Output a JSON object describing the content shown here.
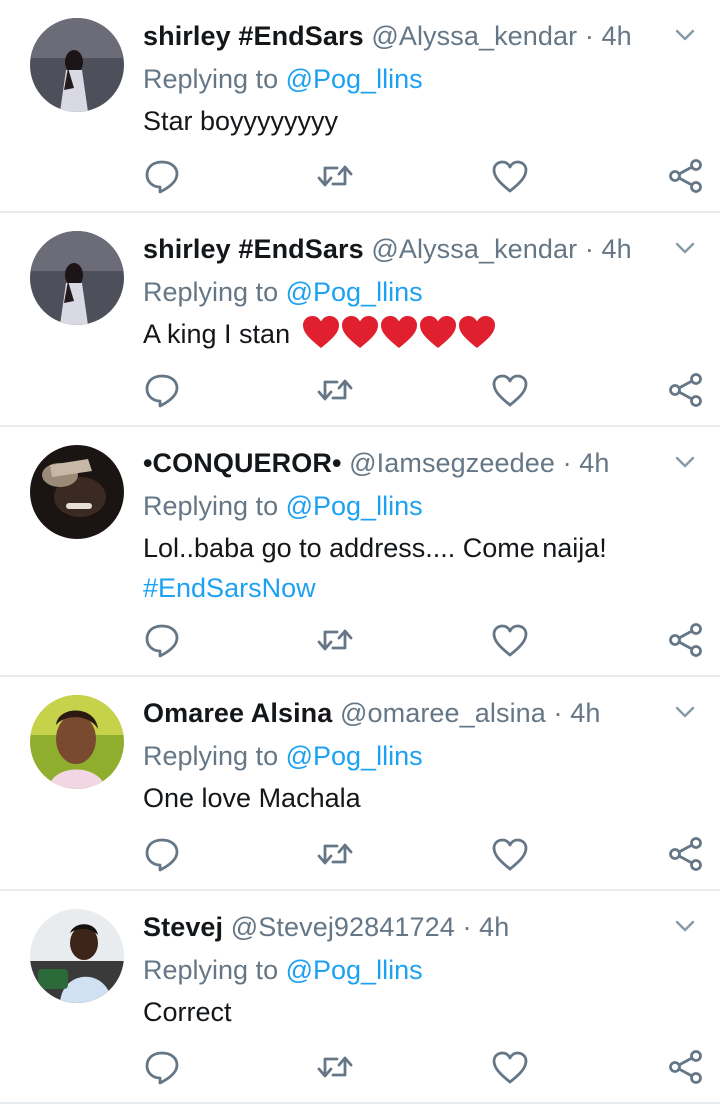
{
  "replying_prefix": "Replying to",
  "tweets": [
    {
      "name": "shirley #EndSars",
      "handle": "@Alyssa_kendar",
      "separator": "·",
      "time": "4h",
      "mention": "@Pog_llins",
      "text": "Star boyyyyyyyy"
    },
    {
      "name": "shirley #EndSars",
      "handle": "@Alyssa_kendar",
      "separator": "·",
      "time": "4h",
      "mention": "@Pog_llins",
      "text": "A king I stan",
      "emoji": [
        "red-heart",
        "red-heart",
        "red-heart",
        "red-heart",
        "red-heart"
      ]
    },
    {
      "name": "•CONQUEROR•",
      "handle": "@Iamsegzeedee",
      "separator": "·",
      "time": "4h",
      "mention": "@Pog_llins",
      "text": "Lol..baba go to address.... Come naija!",
      "hashtag": "#EndSarsNow"
    },
    {
      "name": "Omaree Alsina",
      "handle": "@omaree_alsina",
      "separator": "·",
      "time": "4h",
      "mention": "@Pog_llins",
      "text": "One love Machala"
    },
    {
      "name": "Stevej",
      "handle": "@Stevej92841724",
      "separator": "·",
      "time": "4h",
      "mention": "@Pog_llins",
      "text": "Correct"
    }
  ],
  "icons": {
    "reply": "speech-bubble-icon",
    "retweet": "retweet-icon",
    "like": "heart-icon",
    "share": "share-icon",
    "menu": "chevron-down-icon"
  },
  "colors": {
    "link": "#1da1f2",
    "muted": "#657786",
    "text": "#14171a",
    "divider": "#e6ecf0",
    "emoji_heart": "#e0202e"
  }
}
